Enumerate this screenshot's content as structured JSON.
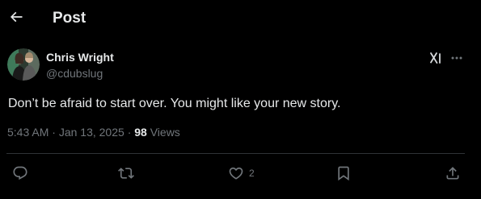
{
  "header": {
    "title": "Post",
    "back_icon": "arrow-left-icon"
  },
  "author": {
    "name": "Chris Wright",
    "handle": "@cdubslug",
    "avatar_icon": "profile-photo"
  },
  "tweet": {
    "text": "Don’t be afraid to start over. You might like your new story."
  },
  "meta": {
    "time": "5:43 AM",
    "separator": "·",
    "date": "Jan 13, 2025",
    "views_count": "98",
    "views_label": "Views"
  },
  "actions": {
    "reply_icon": "reply-icon",
    "repost_icon": "repost-icon",
    "like_icon": "heart-icon",
    "like_count": "2",
    "bookmark_icon": "bookmark-icon",
    "share_icon": "share-icon"
  },
  "colors": {
    "background": "#000000",
    "text_primary": "#e7e9ea",
    "text_secondary": "#71767b",
    "divider": "#2f3336"
  }
}
